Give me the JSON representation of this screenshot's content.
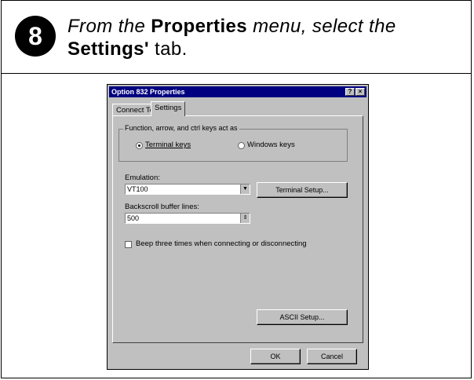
{
  "step": {
    "number": "8"
  },
  "instruction": {
    "part1": "From the ",
    "properties": "Properties",
    "part2": " menu, select the ",
    "settings": "Settings'",
    "part3": " tab."
  },
  "dialog": {
    "title": "Option 832 Properties",
    "tabs": [
      "Connect To",
      "Settings"
    ],
    "active_tab": "Settings",
    "keys_group_label": "Function, arrow, and ctrl keys act as",
    "radio_terminal": "Terminal keys",
    "radio_windows": "Windows keys",
    "emulation_label": "Emulation:",
    "emulation_value": "VT100",
    "terminal_setup_button": "Terminal Setup...",
    "backscroll_label": "Backscroll buffer lines:",
    "backscroll_value": "500",
    "beep_label": "Beep three times when connecting or disconnecting",
    "ascii_button": "ASCII Setup...",
    "ok_button": "OK",
    "cancel_button": "Cancel"
  },
  "colors": {
    "titlebar": "#000080",
    "dialog_bg": "#c0c0c0"
  }
}
